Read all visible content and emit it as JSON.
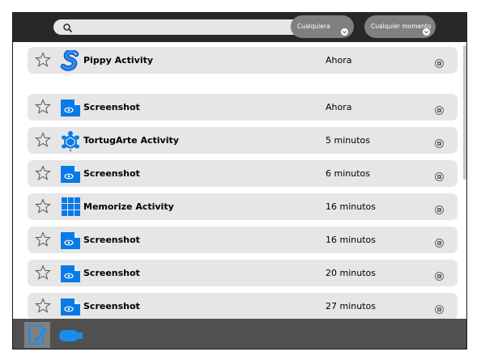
{
  "toolbar": {
    "search_value": "",
    "filter_type": "Cualquiera",
    "filter_time": "Cualquier momento"
  },
  "entries": [
    {
      "title": "Pippy Activity",
      "time": "Ahora",
      "icon": "pippy-icon"
    },
    {
      "title": "Screenshot",
      "time": "Ahora",
      "icon": "image-file-icon"
    },
    {
      "title": "TortugArte Activity",
      "time": "5 minutos",
      "icon": "turtle-icon"
    },
    {
      "title": "Screenshot",
      "time": "6 minutos",
      "icon": "image-file-icon"
    },
    {
      "title": "Memorize Activity",
      "time": "16 minutos",
      "icon": "memorize-grid-icon"
    },
    {
      "title": "Screenshot",
      "time": "16 minutos",
      "icon": "image-file-icon"
    },
    {
      "title": "Screenshot",
      "time": "20 minutos",
      "icon": "image-file-icon"
    },
    {
      "title": "Screenshot",
      "time": "27 minutos",
      "icon": "image-file-icon"
    }
  ],
  "colors": {
    "toolbar": "#282828",
    "row": "#e6e6e6",
    "activity_blue": "#0a7ae6",
    "bottom_bar": "#505050"
  }
}
